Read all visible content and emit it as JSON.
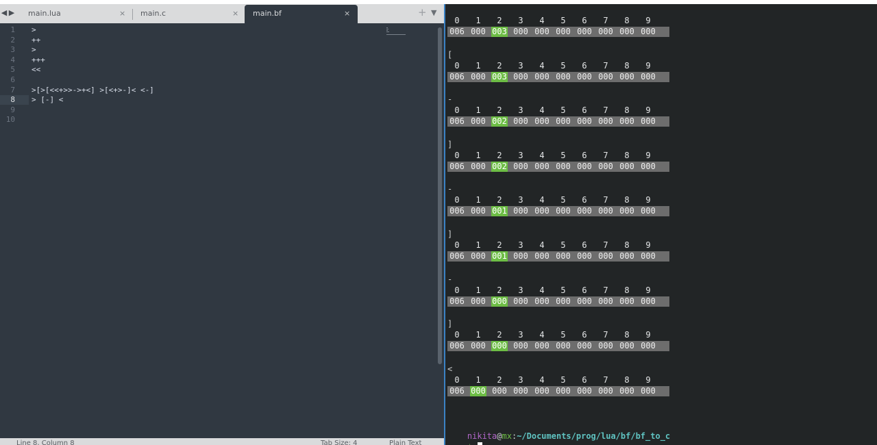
{
  "editor": {
    "tabs": [
      {
        "label": "main.lua",
        "close": "×",
        "active": false
      },
      {
        "label": "main.c",
        "close": "×",
        "active": false
      },
      {
        "label": "main.bf",
        "close": "×",
        "active": true
      }
    ],
    "tab_nav_left": "◀",
    "tab_nav_right": "▶",
    "tab_add": "+",
    "tab_menu": "▼",
    "current_line": 8,
    "lines": [
      {
        "num": "1",
        "text": ">"
      },
      {
        "num": "2",
        "text": "++"
      },
      {
        "num": "3",
        "text": ">"
      },
      {
        "num": "4",
        "text": "+++"
      },
      {
        "num": "5",
        "text": "<<"
      },
      {
        "num": "6",
        "text": ""
      },
      {
        "num": "7",
        "text": ">[>[<<+>>->+<] >[<+>-]< <-]"
      },
      {
        "num": "8",
        "text": "> [-] <"
      },
      {
        "num": "9",
        "text": ""
      },
      {
        "num": "10",
        "text": ""
      }
    ],
    "status": {
      "position": "Line 8, Column 8",
      "tab_size": "Tab Size: 4",
      "syntax": "Plain Text"
    }
  },
  "terminal": {
    "blocks": [
      {
        "op": "",
        "indices": [
          "0",
          "1",
          "2",
          "3",
          "4",
          "5",
          "6",
          "7",
          "8",
          "9"
        ],
        "cells": [
          "006",
          "000",
          "003",
          "000",
          "000",
          "000",
          "000",
          "000",
          "000",
          "000"
        ],
        "pointer": 2
      },
      {
        "op": "[",
        "indices": [
          "0",
          "1",
          "2",
          "3",
          "4",
          "5",
          "6",
          "7",
          "8",
          "9"
        ],
        "cells": [
          "006",
          "000",
          "003",
          "000",
          "000",
          "000",
          "000",
          "000",
          "000",
          "000"
        ],
        "pointer": 2
      },
      {
        "op": "-",
        "indices": [
          "0",
          "1",
          "2",
          "3",
          "4",
          "5",
          "6",
          "7",
          "8",
          "9"
        ],
        "cells": [
          "006",
          "000",
          "002",
          "000",
          "000",
          "000",
          "000",
          "000",
          "000",
          "000"
        ],
        "pointer": 2
      },
      {
        "op": "]",
        "indices": [
          "0",
          "1",
          "2",
          "3",
          "4",
          "5",
          "6",
          "7",
          "8",
          "9"
        ],
        "cells": [
          "006",
          "000",
          "002",
          "000",
          "000",
          "000",
          "000",
          "000",
          "000",
          "000"
        ],
        "pointer": 2
      },
      {
        "op": "-",
        "indices": [
          "0",
          "1",
          "2",
          "3",
          "4",
          "5",
          "6",
          "7",
          "8",
          "9"
        ],
        "cells": [
          "006",
          "000",
          "001",
          "000",
          "000",
          "000",
          "000",
          "000",
          "000",
          "000"
        ],
        "pointer": 2
      },
      {
        "op": "]",
        "indices": [
          "0",
          "1",
          "2",
          "3",
          "4",
          "5",
          "6",
          "7",
          "8",
          "9"
        ],
        "cells": [
          "006",
          "000",
          "001",
          "000",
          "000",
          "000",
          "000",
          "000",
          "000",
          "000"
        ],
        "pointer": 2
      },
      {
        "op": "-",
        "indices": [
          "0",
          "1",
          "2",
          "3",
          "4",
          "5",
          "6",
          "7",
          "8",
          "9"
        ],
        "cells": [
          "006",
          "000",
          "000",
          "000",
          "000",
          "000",
          "000",
          "000",
          "000",
          "000"
        ],
        "pointer": 2
      },
      {
        "op": "]",
        "indices": [
          "0",
          "1",
          "2",
          "3",
          "4",
          "5",
          "6",
          "7",
          "8",
          "9"
        ],
        "cells": [
          "006",
          "000",
          "000",
          "000",
          "000",
          "000",
          "000",
          "000",
          "000",
          "000"
        ],
        "pointer": 2
      },
      {
        "op": "<",
        "indices": [
          "0",
          "1",
          "2",
          "3",
          "4",
          "5",
          "6",
          "7",
          "8",
          "9"
        ],
        "cells": [
          "006",
          "000",
          "000",
          "000",
          "000",
          "000",
          "000",
          "000",
          "000",
          "000"
        ],
        "pointer": 1
      }
    ],
    "prompt": {
      "user": "nikita",
      "at": "@",
      "host": "mx",
      "colon": ":",
      "path": "~/Documents/prog/lua/bf/bf_to_c",
      "symbol": "$"
    }
  },
  "colors": {
    "editor_bg": "#303841",
    "terminal_bg": "#222526",
    "highlight_cell": "#6dbd45",
    "prompt_user": "#b267c9",
    "prompt_host": "#6dbd45",
    "prompt_path": "#5fc3c1",
    "split_border": "#3b83c6"
  }
}
